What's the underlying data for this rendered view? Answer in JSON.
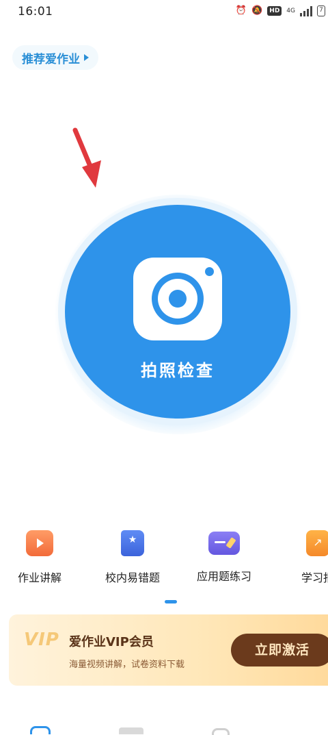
{
  "status_bar": {
    "time": "16:01",
    "network": "4G",
    "hd": "HD",
    "battery": "7"
  },
  "recommend": {
    "label": "推荐爱作业"
  },
  "camera": {
    "label": "拍照检查",
    "accent": "#2e93ea"
  },
  "features": [
    {
      "label": "作业讲解",
      "icon": "video-play-icon"
    },
    {
      "label": "校内易错题",
      "icon": "star-book-icon"
    },
    {
      "label": "应用题练习",
      "icon": "card-pencil-icon"
    },
    {
      "label": "学习报",
      "icon": "report-chart-icon"
    }
  ],
  "vip": {
    "logo": "VIP",
    "title": "爱作业VIP会员",
    "subtitle": "海量视频讲解，试卷资料下载",
    "button": "立即激活"
  },
  "colors": {
    "accent": "#2e93ea",
    "vip_button": "#6b3a1c",
    "annotation_arrow": "#e0393e"
  }
}
